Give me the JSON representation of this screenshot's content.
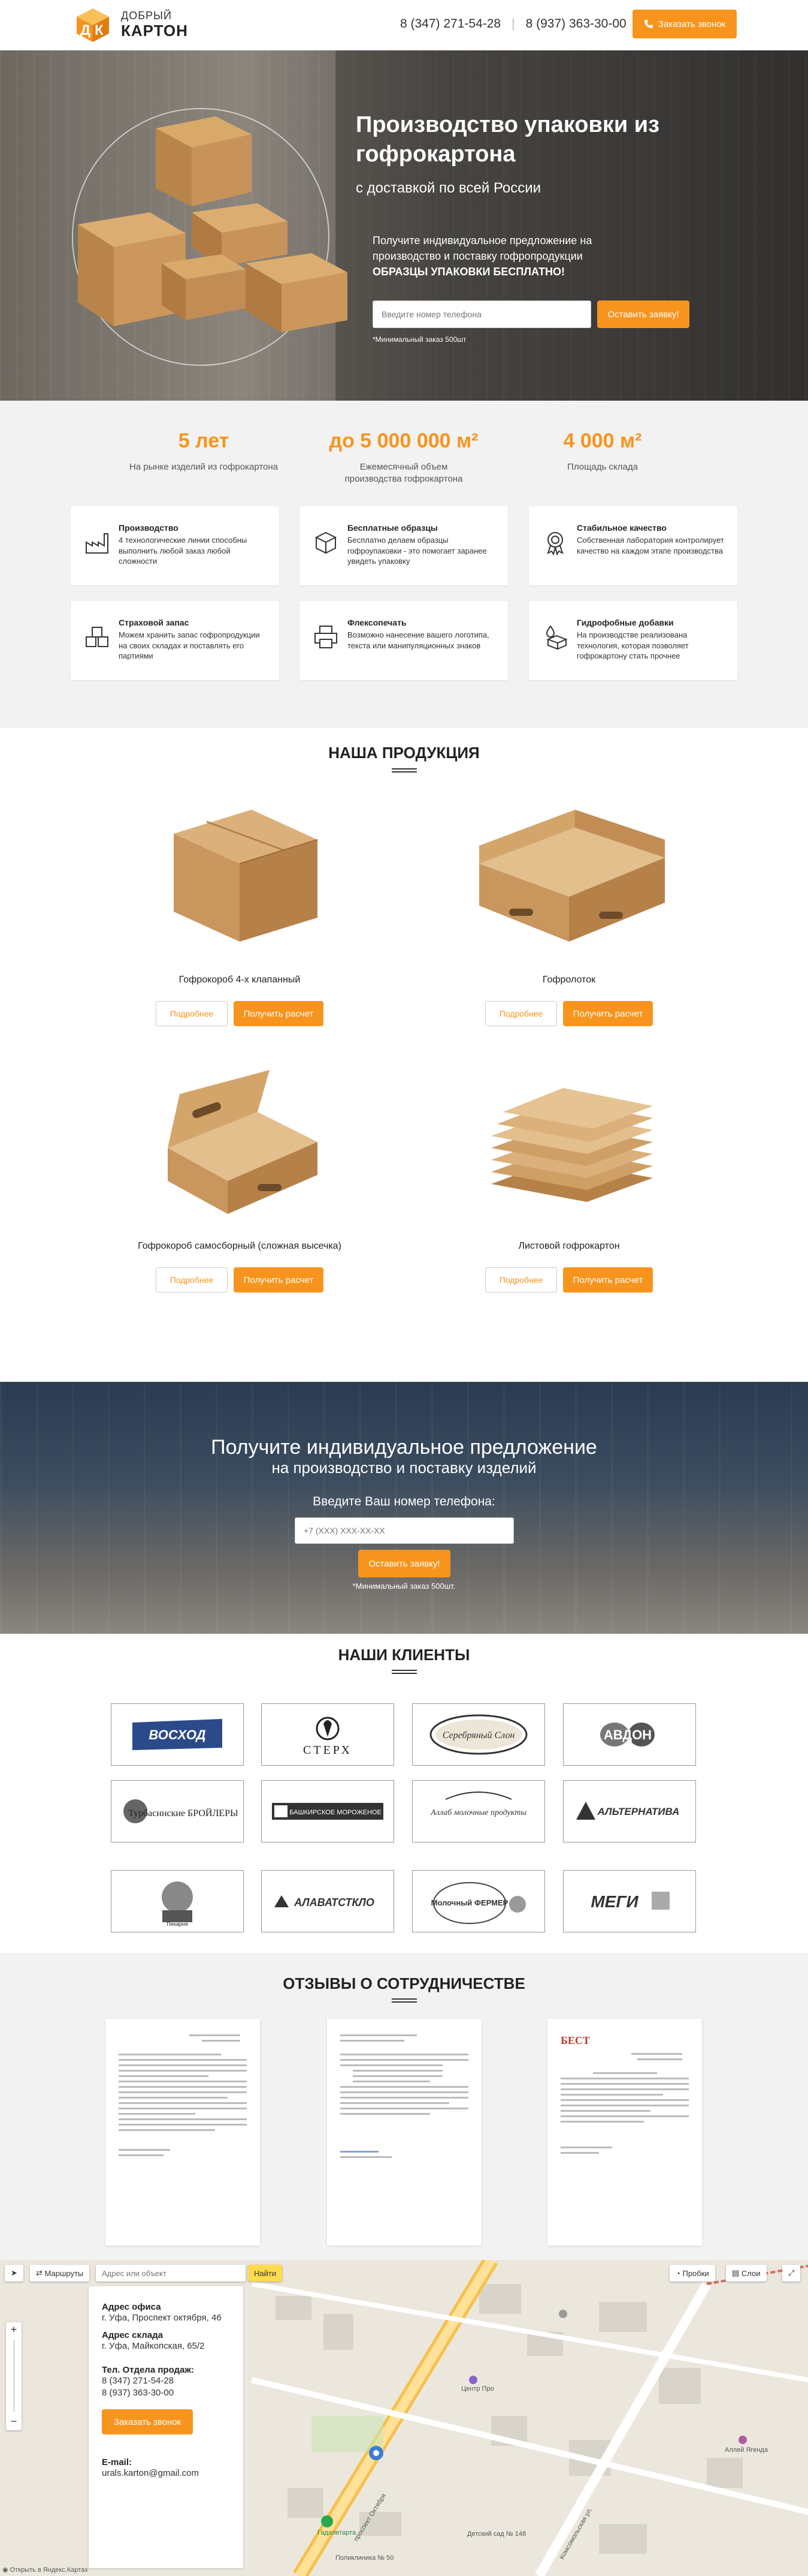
{
  "header": {
    "logo_line1": "ДОБРЫЙ",
    "logo_line2": "КАРТОН",
    "phone1": "8 (347) 271-54-28",
    "phone2": "8 (937) 363-30-00",
    "call_button": "Заказать звонок"
  },
  "hero": {
    "title": "Производство упаковки из гофрокартона",
    "subtitle": "с доставкой по всей России",
    "offer": "Получите индивидуальное предложение на производство и поставку гофропродукции",
    "offer_bold": "ОБРАЗЦЫ УПАКОВКИ БЕСПЛАТНО!",
    "phone_placeholder": "Введите номер телефона",
    "submit": "Оставить заявку!",
    "note": "*Минимальный заказ 500шт"
  },
  "stats": [
    {
      "num": "5 лет",
      "label": "На рынке изделий из гофрокартона"
    },
    {
      "num": "до 5 000 000 м²",
      "label": "Ежемесячный объем производства гофрокартона"
    },
    {
      "num": "4 000 м²",
      "label": "Площадь склада"
    }
  ],
  "features": [
    {
      "title": "Производство",
      "desc": "4 технологические линии способны выполнить любой заказ любой сложности",
      "icon": "factory-icon"
    },
    {
      "title": "Бесплатные образцы",
      "desc": "Бесплатно делаем образцы гофроупаковки - это помогает заранее увидеть упаковку",
      "icon": "box-icon"
    },
    {
      "title": "Стабильное качество",
      "desc": "Собственная лаборатория контролирует качество на каждом этапе производства",
      "icon": "medal-icon"
    },
    {
      "title": "Страховой запас",
      "desc": "Можем хранить запас гофропродукции на своих складах и поставлять его партиями",
      "icon": "boxes-icon"
    },
    {
      "title": "Флексопечать",
      "desc": "Возможно нанесение вашего логотипа, текста или манипуляционных знаков",
      "icon": "print-icon"
    },
    {
      "title": "Гидрофобные добавки",
      "desc": "На производстве реализована технология, которая позволяет гофрокартону стать прочнее",
      "icon": "water-box-icon"
    }
  ],
  "products": {
    "title": "НАША ПРОДУКЦИЯ",
    "more_label": "Подробнее",
    "calc_label": "Получить расчет",
    "items": [
      {
        "name": "Гофрокороб 4-х клапанный"
      },
      {
        "name": "Гофролоток"
      },
      {
        "name": "Гофрокороб самосборный (сложная высечка)"
      },
      {
        "name": "Листовой гофрокартон"
      }
    ]
  },
  "cta": {
    "line1": "Получите индивидуальное предложение",
    "line2": "на производство и поставку изделий",
    "line3": "Введите Ваш номер телефона:",
    "placeholder": "+7 (XXX) XXX-XX-XX",
    "submit": "Оставить заявку!",
    "note": "*Минимальный заказ 500шт."
  },
  "clients": {
    "title": "НАШИ КЛИЕНТЫ",
    "logos": [
      "ВОСХОД",
      "СТЕРХ",
      "Серебряный Слон",
      "АВДОН",
      "Турбасинские БРОЙЛЕРЫ",
      "БАШКИРСКОЕ МОРОЖЕНОЕ",
      "Аллаб молочные продукты",
      "АЛЬТЕРНАТИВА",
      "Пекарня",
      "АЛАВАТСТКЛО",
      "Молочный ФЕРМЕР",
      "МЕГИ"
    ]
  },
  "reviews": {
    "title": "ОТЗЫВЫ О СОТРУДНИЧЕСТВЕ",
    "doc3_header": "БЕСТ"
  },
  "map": {
    "routes": "Маршруты",
    "search_placeholder": "Адрес или объект",
    "find": "Найти",
    "traffic": "Пробки",
    "layers": "Слои",
    "office_label": "Адрес офиса",
    "office": "г. Уфа, Проспект октября, 46",
    "warehouse_label": "Адрес склада",
    "warehouse": "г. Уфа, Майкопская, 65/2",
    "sales_label": "Тел. Отдела продаж:",
    "sales_phone1": "8 (347) 271-54-28",
    "sales_phone2": "8 (937) 363-30-00",
    "call_button": "Заказать звонок",
    "email_label": "E-mail:",
    "email": "urals.karton@gmail.com",
    "open_link": "Открыть в Яндекс.Картах",
    "street1": "проспект Октября",
    "street2": "Комсомольская ул.",
    "poi1": "Гадалетарта",
    "poi2": "Центр Про",
    "poi3": "Поликлиника № 50",
    "poi4": "Аллей Ягенда",
    "poi5": "Детский сад № 148"
  }
}
